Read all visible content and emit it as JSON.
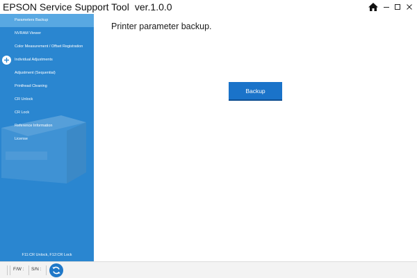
{
  "window": {
    "title": "EPSON Service Support Tool",
    "version": "ver.1.0.0",
    "icons": {
      "home": "home-icon",
      "minimize": "minimize-icon",
      "maximize": "maximize-icon",
      "close": "close-icon"
    }
  },
  "sidebar": {
    "items": [
      {
        "label": "Parameters Backup",
        "active": true
      },
      {
        "label": "NVRAM Viewer"
      },
      {
        "label": "Color Measurement / Offset Registration"
      },
      {
        "label": "Individual Adjustments",
        "icon": "plus-icon"
      },
      {
        "label": "Adjustment (Sequential)"
      },
      {
        "label": "Printhead Cleaning"
      },
      {
        "label": "CR Unlock"
      },
      {
        "label": "CR Lock"
      },
      {
        "label": "Reference Information"
      },
      {
        "label": "License"
      }
    ],
    "footer": "F11:CR Unlock, F12:CR Lock"
  },
  "main": {
    "heading": "Printer parameter backup.",
    "backup_button": "Backup"
  },
  "statusbar": {
    "fw_label": "F/W :",
    "sn_label": "S/N :",
    "refresh_icon": "refresh-icon"
  },
  "colors": {
    "sidebar": "#2a86d0",
    "sidebar_active": "#58a8e2",
    "button": "#1a73c9"
  }
}
